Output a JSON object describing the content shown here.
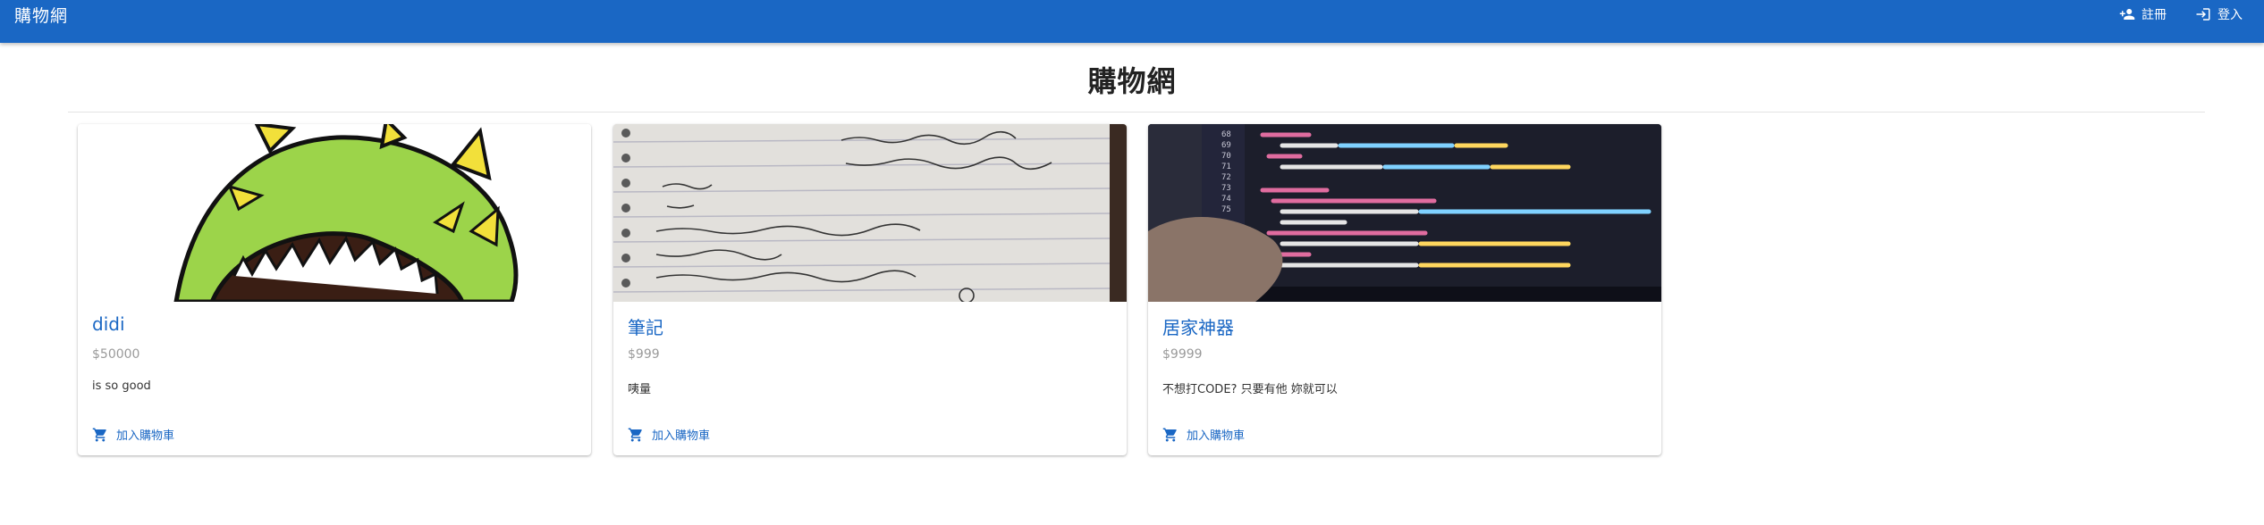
{
  "app": {
    "title": "購物網",
    "nav": [
      {
        "label": "註冊",
        "icon": "person-add-icon"
      },
      {
        "label": "登入",
        "icon": "login-icon"
      }
    ]
  },
  "page": {
    "heading": "購物網"
  },
  "products": [
    {
      "name": "didi",
      "price": "$50000",
      "description": "is so good",
      "cart_label": "加入購物車",
      "image": "green-dinosaur-cartoon"
    },
    {
      "name": "筆記",
      "price": "$999",
      "description": "咦量",
      "cart_label": "加入購物車",
      "image": "handwritten-notebook-photo"
    },
    {
      "name": "居家神器",
      "price": "$9999",
      "description": "不想打CODE? 只要有他 妳就可以",
      "cart_label": "加入購物車",
      "image": "code-on-screen-photo"
    }
  ],
  "colors": {
    "appbar": "#1a67c4",
    "accent": "#1a67c4",
    "price": "#9a9a9a"
  }
}
